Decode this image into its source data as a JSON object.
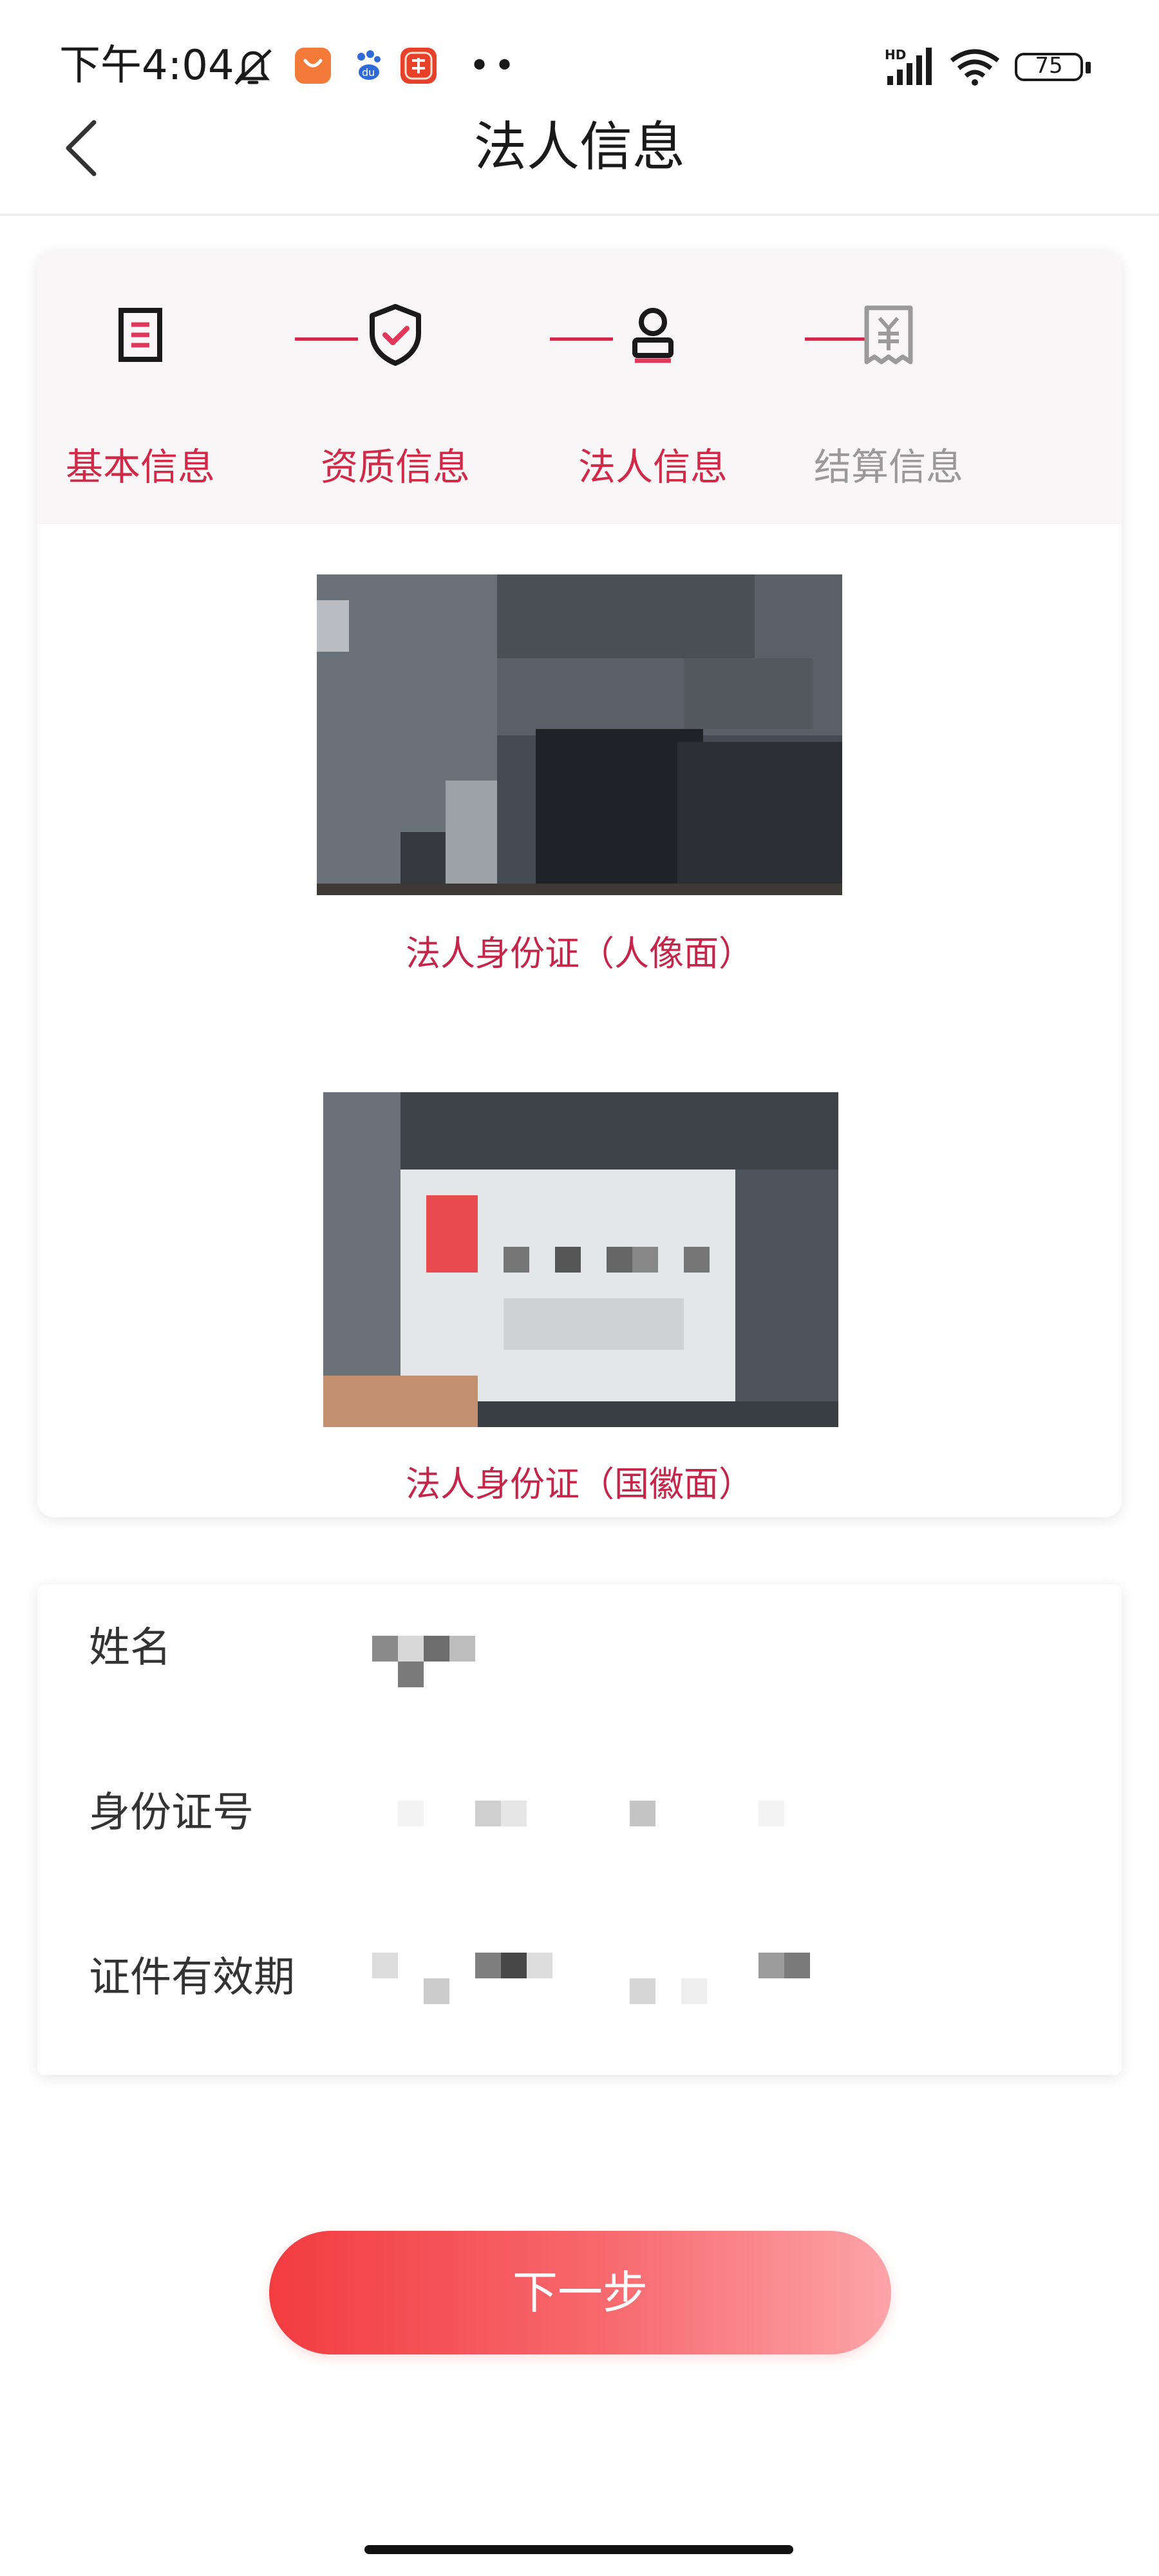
{
  "status_bar": {
    "time": "下午4:04",
    "battery": "75",
    "network": "HD",
    "icons": [
      "mute-icon",
      "shopping-app-icon",
      "baidu-icon",
      "taobao-icon",
      "more-dots-icon",
      "signal-icon",
      "wifi-icon",
      "battery-icon"
    ]
  },
  "nav": {
    "back_icon": "chevron-left-icon",
    "title": "法人信息"
  },
  "steps": [
    {
      "label": "基本信息",
      "icon": "document-icon",
      "state": "done"
    },
    {
      "label": "资质信息",
      "icon": "shield-check-icon",
      "state": "done"
    },
    {
      "label": "法人信息",
      "icon": "person-icon",
      "state": "active"
    },
    {
      "label": "结算信息",
      "icon": "yuan-receipt-icon",
      "state": "pending"
    }
  ],
  "uploads": {
    "front_caption": "法人身份证（人像面）",
    "back_caption": "法人身份证（国徽面）"
  },
  "form": {
    "name_label": "姓名",
    "id_number_label": "身份证号",
    "validity_label": "证件有效期"
  },
  "next_button": "下一步",
  "colors": {
    "accent": "#d02a48",
    "caption": "#c4264a",
    "pending": "#999999",
    "button_start": "#f23c40",
    "button_end": "#fca4a8"
  }
}
